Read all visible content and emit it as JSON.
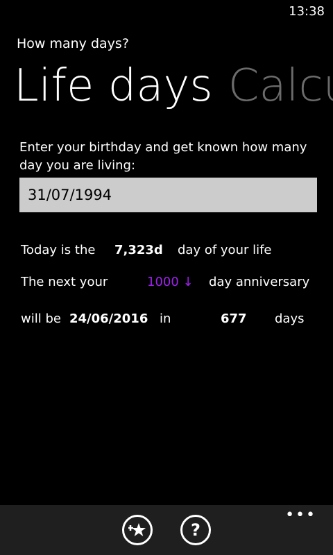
{
  "status": {
    "time": "13:38"
  },
  "app": {
    "title": "How many days?"
  },
  "pivot": {
    "active": "Life days",
    "inactive": "Calcu"
  },
  "instructions": "Enter your birthday and get known how many day you are living:",
  "birthday_input": {
    "value": "31/07/1994"
  },
  "result": {
    "line1": {
      "prefix": "Today is the",
      "days": "7,323d",
      "suffix": "day of your life"
    },
    "line2": {
      "prefix": "The next your",
      "anniversary_value": "1000 ↓",
      "suffix": "day anniversary"
    },
    "line3": {
      "prefix": "will be",
      "date": "24/06/2016",
      "in": "in",
      "remaining": "677",
      "unit": "days"
    }
  },
  "appbar": {
    "more": "•••"
  },
  "icons": {
    "pin": "pin-star-icon",
    "help": "help-icon"
  },
  "colors": {
    "accent": "#a020f0",
    "background": "#000000",
    "appbar": "#1f1f1f"
  }
}
